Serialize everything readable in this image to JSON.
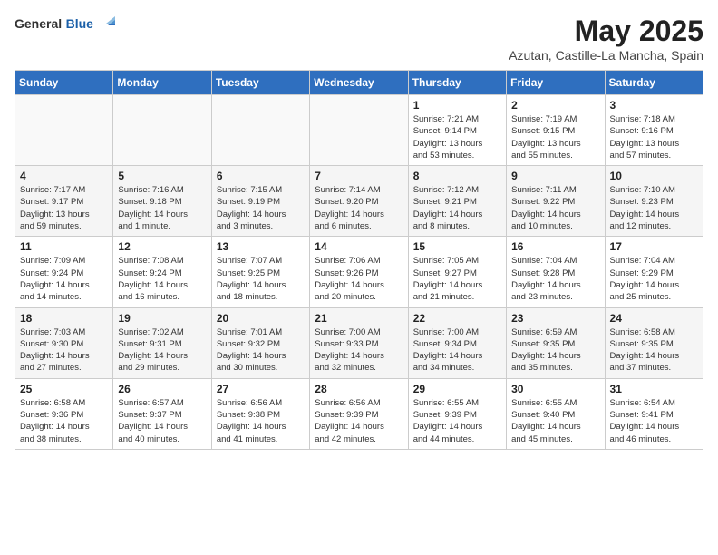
{
  "header": {
    "logo_general": "General",
    "logo_blue": "Blue",
    "month": "May 2025",
    "location": "Azutan, Castille-La Mancha, Spain"
  },
  "weekdays": [
    "Sunday",
    "Monday",
    "Tuesday",
    "Wednesday",
    "Thursday",
    "Friday",
    "Saturday"
  ],
  "weeks": [
    [
      {
        "day": "",
        "info": ""
      },
      {
        "day": "",
        "info": ""
      },
      {
        "day": "",
        "info": ""
      },
      {
        "day": "",
        "info": ""
      },
      {
        "day": "1",
        "info": "Sunrise: 7:21 AM\nSunset: 9:14 PM\nDaylight: 13 hours\nand 53 minutes."
      },
      {
        "day": "2",
        "info": "Sunrise: 7:19 AM\nSunset: 9:15 PM\nDaylight: 13 hours\nand 55 minutes."
      },
      {
        "day": "3",
        "info": "Sunrise: 7:18 AM\nSunset: 9:16 PM\nDaylight: 13 hours\nand 57 minutes."
      }
    ],
    [
      {
        "day": "4",
        "info": "Sunrise: 7:17 AM\nSunset: 9:17 PM\nDaylight: 13 hours\nand 59 minutes."
      },
      {
        "day": "5",
        "info": "Sunrise: 7:16 AM\nSunset: 9:18 PM\nDaylight: 14 hours\nand 1 minute."
      },
      {
        "day": "6",
        "info": "Sunrise: 7:15 AM\nSunset: 9:19 PM\nDaylight: 14 hours\nand 3 minutes."
      },
      {
        "day": "7",
        "info": "Sunrise: 7:14 AM\nSunset: 9:20 PM\nDaylight: 14 hours\nand 6 minutes."
      },
      {
        "day": "8",
        "info": "Sunrise: 7:12 AM\nSunset: 9:21 PM\nDaylight: 14 hours\nand 8 minutes."
      },
      {
        "day": "9",
        "info": "Sunrise: 7:11 AM\nSunset: 9:22 PM\nDaylight: 14 hours\nand 10 minutes."
      },
      {
        "day": "10",
        "info": "Sunrise: 7:10 AM\nSunset: 9:23 PM\nDaylight: 14 hours\nand 12 minutes."
      }
    ],
    [
      {
        "day": "11",
        "info": "Sunrise: 7:09 AM\nSunset: 9:24 PM\nDaylight: 14 hours\nand 14 minutes."
      },
      {
        "day": "12",
        "info": "Sunrise: 7:08 AM\nSunset: 9:24 PM\nDaylight: 14 hours\nand 16 minutes."
      },
      {
        "day": "13",
        "info": "Sunrise: 7:07 AM\nSunset: 9:25 PM\nDaylight: 14 hours\nand 18 minutes."
      },
      {
        "day": "14",
        "info": "Sunrise: 7:06 AM\nSunset: 9:26 PM\nDaylight: 14 hours\nand 20 minutes."
      },
      {
        "day": "15",
        "info": "Sunrise: 7:05 AM\nSunset: 9:27 PM\nDaylight: 14 hours\nand 21 minutes."
      },
      {
        "day": "16",
        "info": "Sunrise: 7:04 AM\nSunset: 9:28 PM\nDaylight: 14 hours\nand 23 minutes."
      },
      {
        "day": "17",
        "info": "Sunrise: 7:04 AM\nSunset: 9:29 PM\nDaylight: 14 hours\nand 25 minutes."
      }
    ],
    [
      {
        "day": "18",
        "info": "Sunrise: 7:03 AM\nSunset: 9:30 PM\nDaylight: 14 hours\nand 27 minutes."
      },
      {
        "day": "19",
        "info": "Sunrise: 7:02 AM\nSunset: 9:31 PM\nDaylight: 14 hours\nand 29 minutes."
      },
      {
        "day": "20",
        "info": "Sunrise: 7:01 AM\nSunset: 9:32 PM\nDaylight: 14 hours\nand 30 minutes."
      },
      {
        "day": "21",
        "info": "Sunrise: 7:00 AM\nSunset: 9:33 PM\nDaylight: 14 hours\nand 32 minutes."
      },
      {
        "day": "22",
        "info": "Sunrise: 7:00 AM\nSunset: 9:34 PM\nDaylight: 14 hours\nand 34 minutes."
      },
      {
        "day": "23",
        "info": "Sunrise: 6:59 AM\nSunset: 9:35 PM\nDaylight: 14 hours\nand 35 minutes."
      },
      {
        "day": "24",
        "info": "Sunrise: 6:58 AM\nSunset: 9:35 PM\nDaylight: 14 hours\nand 37 minutes."
      }
    ],
    [
      {
        "day": "25",
        "info": "Sunrise: 6:58 AM\nSunset: 9:36 PM\nDaylight: 14 hours\nand 38 minutes."
      },
      {
        "day": "26",
        "info": "Sunrise: 6:57 AM\nSunset: 9:37 PM\nDaylight: 14 hours\nand 40 minutes."
      },
      {
        "day": "27",
        "info": "Sunrise: 6:56 AM\nSunset: 9:38 PM\nDaylight: 14 hours\nand 41 minutes."
      },
      {
        "day": "28",
        "info": "Sunrise: 6:56 AM\nSunset: 9:39 PM\nDaylight: 14 hours\nand 42 minutes."
      },
      {
        "day": "29",
        "info": "Sunrise: 6:55 AM\nSunset: 9:39 PM\nDaylight: 14 hours\nand 44 minutes."
      },
      {
        "day": "30",
        "info": "Sunrise: 6:55 AM\nSunset: 9:40 PM\nDaylight: 14 hours\nand 45 minutes."
      },
      {
        "day": "31",
        "info": "Sunrise: 6:54 AM\nSunset: 9:41 PM\nDaylight: 14 hours\nand 46 minutes."
      }
    ]
  ]
}
